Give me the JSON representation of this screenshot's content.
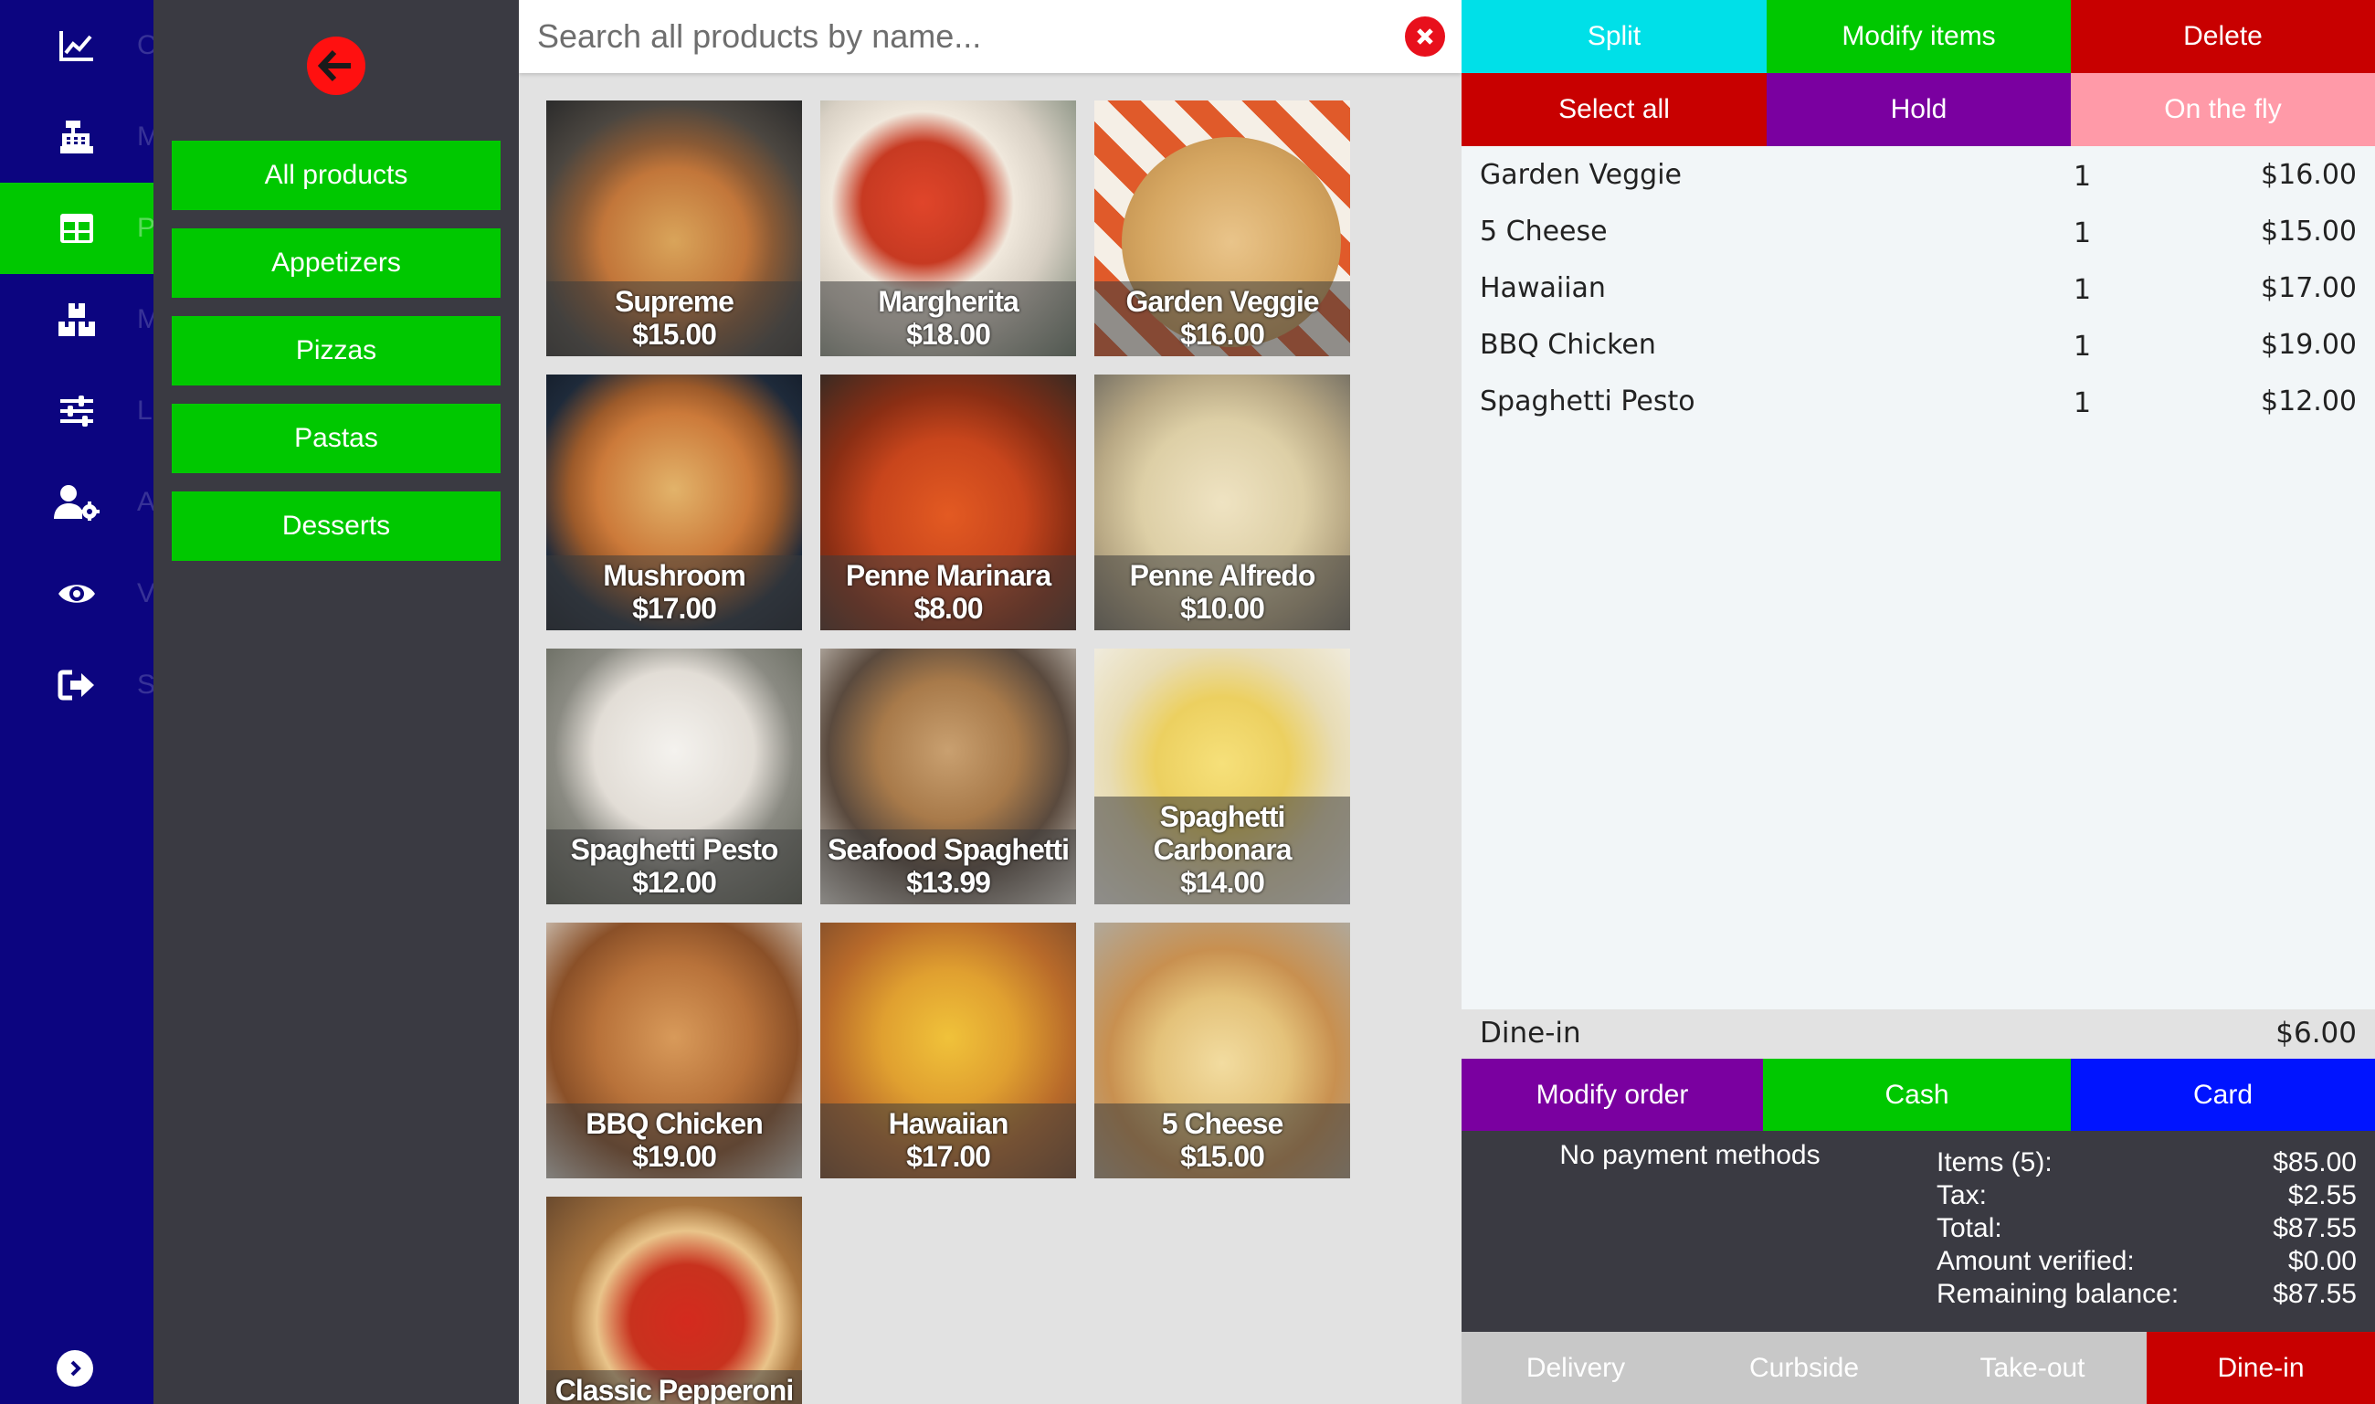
{
  "colors": {
    "rail": "#0c0580",
    "accent_green": "#00c800",
    "split": "#00e0e8",
    "delete": "#c80000",
    "hold": "#7a00a0",
    "on_the_fly": "#ff9aa8",
    "card": "#0014ff"
  },
  "rail": {
    "items": [
      {
        "icon": "chart-line-icon",
        "ghost": "C"
      },
      {
        "icon": "cash-register-icon",
        "ghost": "M"
      },
      {
        "icon": "table-grid-icon",
        "ghost": "P"
      },
      {
        "icon": "boxes-icon",
        "ghost": "M"
      },
      {
        "icon": "sliders-icon",
        "ghost": "L"
      },
      {
        "icon": "user-gear-icon",
        "ghost": "A"
      },
      {
        "icon": "eye-icon",
        "ghost": "V"
      },
      {
        "icon": "sign-out-icon",
        "ghost": "S"
      }
    ],
    "expand_icon": "chevron-right-circle-icon"
  },
  "categories": {
    "back_icon": "arrow-left-circle-icon",
    "items": [
      "All products",
      "Appetizers",
      "Pizzas",
      "Pastas",
      "Desserts"
    ]
  },
  "search": {
    "placeholder": "Search all products by name...",
    "value": ""
  },
  "products": [
    {
      "name": "Supreme",
      "price": "$15.00",
      "bg": "pizza-supreme"
    },
    {
      "name": "Margherita",
      "price": "$18.00",
      "bg": "pizza-margherita"
    },
    {
      "name": "Garden Veggie",
      "price": "$16.00",
      "bg": "pizza-veggie"
    },
    {
      "name": "Mushroom",
      "price": "$17.00",
      "bg": "pizza-mushroom"
    },
    {
      "name": "Penne Marinara",
      "price": "$8.00",
      "bg": "pasta-marinara"
    },
    {
      "name": "Penne Alfredo",
      "price": "$10.00",
      "bg": "pasta-alfredo"
    },
    {
      "name": "Spaghetti Pesto",
      "price": "$12.00",
      "bg": "pasta-pesto"
    },
    {
      "name": "Seafood Spaghetti",
      "price": "$13.99",
      "bg": "pasta-seafood"
    },
    {
      "name": "Spaghetti Carbonara",
      "price": "$14.00",
      "bg": "pasta-carbonara"
    },
    {
      "name": "BBQ Chicken",
      "price": "$19.00",
      "bg": "pizza-bbq"
    },
    {
      "name": "Hawaiian",
      "price": "$17.00",
      "bg": "pizza-hawaiian"
    },
    {
      "name": "5 Cheese",
      "price": "$15.00",
      "bg": "pizza-cheese"
    },
    {
      "name": "Classic Pepperoni",
      "price": "",
      "bg": "pizza-pepperoni"
    }
  ],
  "actions": {
    "split": "Split",
    "modify_items": "Modify items",
    "delete": "Delete",
    "select_all": "Select all",
    "hold": "Hold",
    "on_the_fly": "On the fly"
  },
  "order_items": [
    {
      "name": "Garden Veggie",
      "qty": "1",
      "price": "$16.00"
    },
    {
      "name": "5 Cheese",
      "qty": "1",
      "price": "$15.00"
    },
    {
      "name": "Hawaiian",
      "qty": "1",
      "price": "$17.00"
    },
    {
      "name": "BBQ Chicken",
      "qty": "1",
      "price": "$19.00"
    },
    {
      "name": "Spaghetti Pesto",
      "qty": "1",
      "price": "$12.00"
    }
  ],
  "dine_in_fee": {
    "label": "Dine-in",
    "value": "$6.00"
  },
  "payment": {
    "modify_order": "Modify order",
    "cash": "Cash",
    "card": "Card",
    "no_methods": "No payment methods"
  },
  "summary": [
    {
      "label": "Items (5):",
      "value": "$85.00"
    },
    {
      "label": "Tax:",
      "value": "$2.55"
    },
    {
      "label": "Total:",
      "value": "$87.55"
    },
    {
      "label": "Amount verified:",
      "value": "$0.00"
    },
    {
      "label": "Remaining balance:",
      "value": "$87.55"
    }
  ],
  "order_types": {
    "items": [
      "Delivery",
      "Curbside",
      "Take-out",
      "Dine-in"
    ],
    "active": "Dine-in"
  }
}
